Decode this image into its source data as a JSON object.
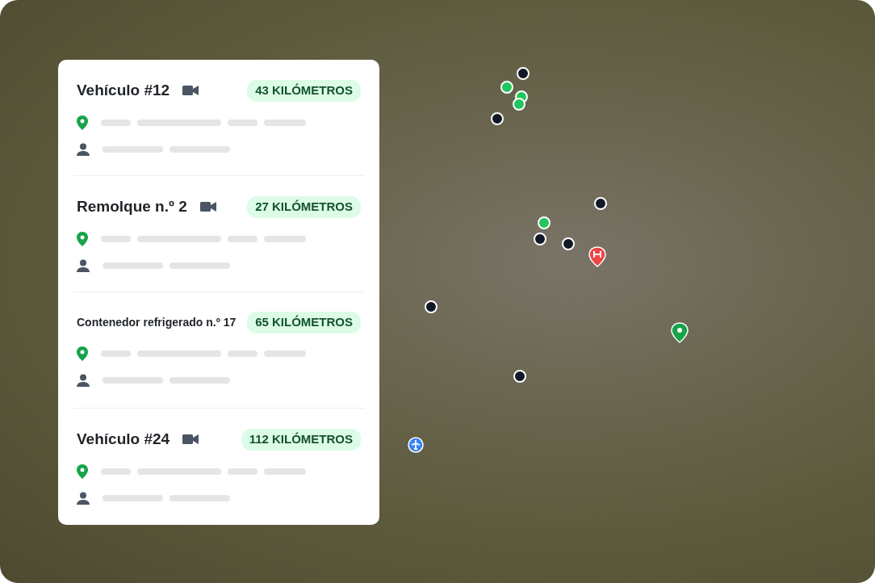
{
  "vehicles": [
    {
      "title": "Vehículo #12",
      "compact": false,
      "camera": true,
      "distance": "43 KILÓMETROS"
    },
    {
      "title": "Remolque n.º 2",
      "compact": false,
      "camera": true,
      "distance": "27 KILÓMETROS"
    },
    {
      "title": "Contenedor refrigerado n.º 17",
      "compact": true,
      "camera": false,
      "distance": "65 KILÓMETROS"
    },
    {
      "title": "Vehículo #24",
      "compact": false,
      "camera": true,
      "distance": "112 KILÓMETROS"
    }
  ],
  "markers": [
    {
      "kind": "dot",
      "color": "#22c55e"
    },
    {
      "kind": "dot",
      "color": "#22c55e"
    },
    {
      "kind": "dot",
      "color": "#22c55e"
    },
    {
      "kind": "dot",
      "color": "#22c55e"
    },
    {
      "kind": "dot",
      "color": "#111827"
    },
    {
      "kind": "dot",
      "color": "#111827"
    },
    {
      "kind": "dot",
      "color": "#111827"
    },
    {
      "kind": "dot",
      "color": "#111827"
    },
    {
      "kind": "dot",
      "color": "#111827"
    },
    {
      "kind": "dot",
      "color": "#111827"
    },
    {
      "kind": "dot",
      "color": "#111827"
    },
    {
      "kind": "hospital",
      "color": "#ef4444"
    },
    {
      "kind": "pin",
      "color": "#16a34a"
    },
    {
      "kind": "airport",
      "color": "#3b82f6"
    }
  ]
}
